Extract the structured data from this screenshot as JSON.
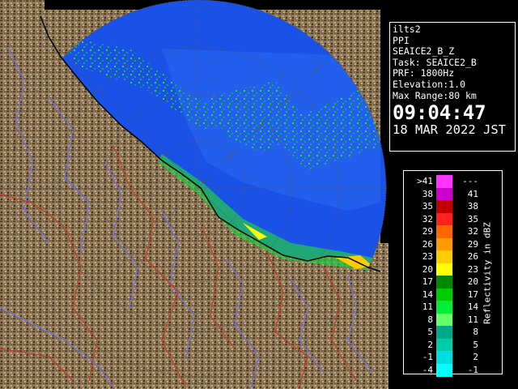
{
  "info": {
    "site": "ilts2",
    "product": "PPI",
    "scan": "SEAICE2_B_Z",
    "task": "Task: SEAICE2_B",
    "prf": "PRF: 1800Hz",
    "elevation": "Elevation:1.0",
    "max_range": "Max Range:80 km",
    "time": "09:04:47",
    "date": "18 MAR 2022 JST"
  },
  "legend": {
    "title": "Reflectivity in dBZ",
    "levels": [
      {
        "low": ">41",
        "high": "---",
        "color": "#ff33ff"
      },
      {
        "low": "38",
        "high": "41",
        "color": "#cc00cc"
      },
      {
        "low": "35",
        "high": "38",
        "color": "#c00000"
      },
      {
        "low": "32",
        "high": "35",
        "color": "#ff2020"
      },
      {
        "low": "29",
        "high": "32",
        "color": "#ff6600"
      },
      {
        "low": "26",
        "high": "29",
        "color": "#ff9900"
      },
      {
        "low": "23",
        "high": "26",
        "color": "#ffcc00"
      },
      {
        "low": "20",
        "high": "23",
        "color": "#ffff00"
      },
      {
        "low": "17",
        "high": "20",
        "color": "#008800"
      },
      {
        "low": "14",
        "high": "17",
        "color": "#00cc00"
      },
      {
        "low": "11",
        "high": "14",
        "color": "#00ee33"
      },
      {
        "low": "8",
        "high": "11",
        "color": "#66ff66"
      },
      {
        "low": "5",
        "high": "8",
        "color": "#00aa88"
      },
      {
        "low": "2",
        "high": "5",
        "color": "#00ccaa"
      },
      {
        "low": "-1",
        "high": "2",
        "color": "#00dddd"
      },
      {
        "low": "-4",
        "high": "-1",
        "color": "#00ffff"
      }
    ]
  },
  "map": {
    "land_color": "#8a7656",
    "sea_color": "#1a52e8",
    "outside_color": "#000000",
    "river_color": "#6a72ff",
    "boundary_color": "#cc3322"
  }
}
